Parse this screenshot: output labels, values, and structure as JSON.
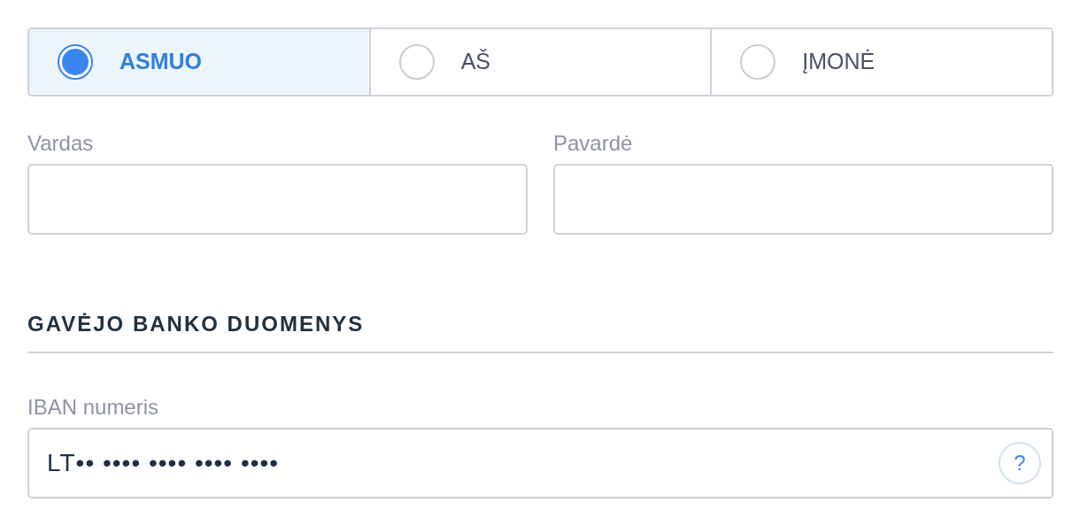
{
  "recipient_type": [
    {
      "label": "ASMUO",
      "selected": true
    },
    {
      "label": "AŠ",
      "selected": false
    },
    {
      "label": "ĮMONĖ",
      "selected": false
    }
  ],
  "fields": [
    {
      "label": "Vardas"
    },
    {
      "label": "Pavardė"
    }
  ],
  "bank_section": {
    "title": "GAVĖJO BANKO DUOMENYS",
    "iban": {
      "label": "IBAN numeris",
      "value": "LT•• •••• •••• •••• ••••",
      "help": "?"
    }
  }
}
